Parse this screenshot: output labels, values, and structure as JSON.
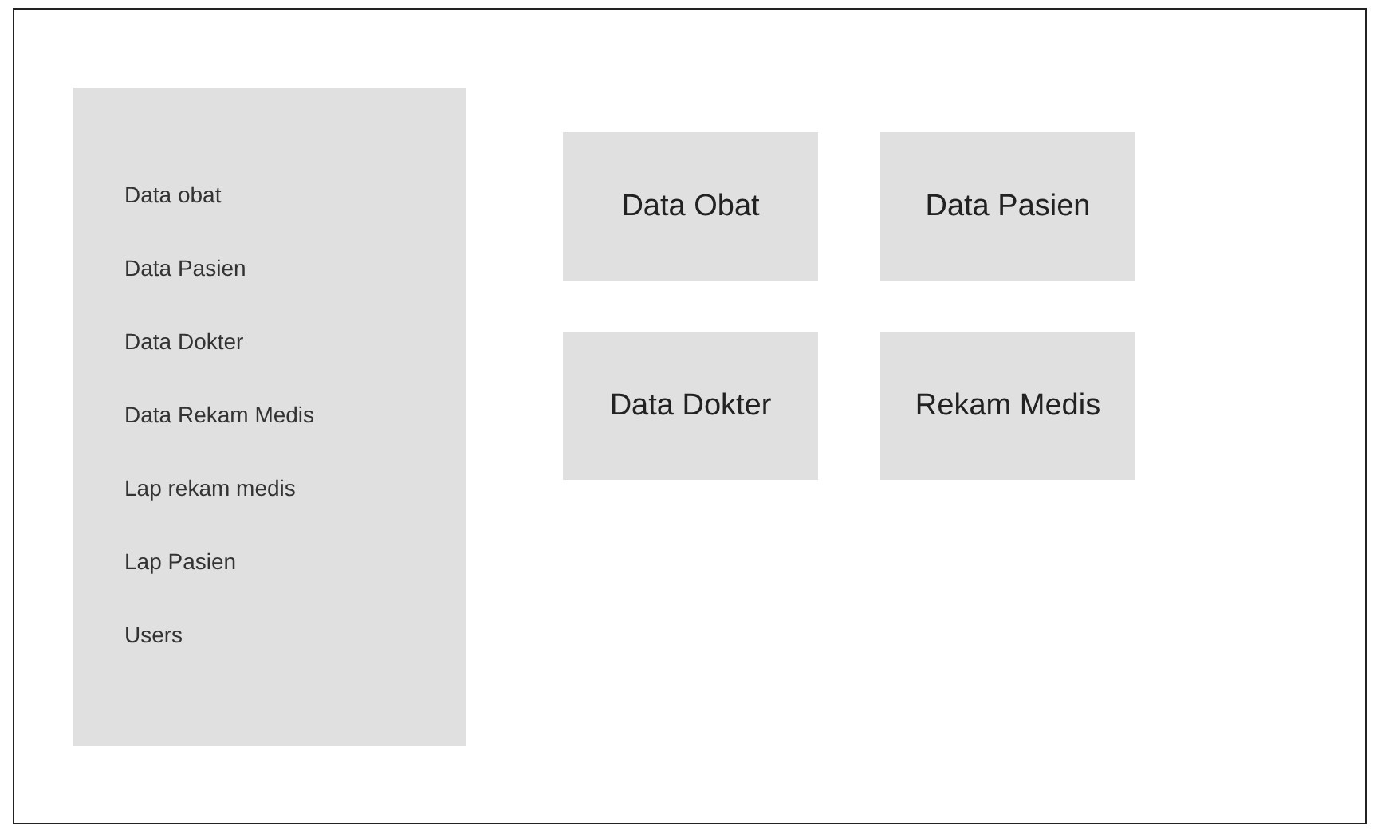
{
  "sidebar": {
    "items": [
      {
        "label": "Data obat"
      },
      {
        "label": "Data Pasien"
      },
      {
        "label": "Data Dokter"
      },
      {
        "label": "Data Rekam Medis"
      },
      {
        "label": "Lap rekam medis"
      },
      {
        "label": "Lap Pasien"
      },
      {
        "label": "Users"
      }
    ]
  },
  "cards": [
    {
      "label": "Data Obat"
    },
    {
      "label": "Data Pasien"
    },
    {
      "label": "Data Dokter"
    },
    {
      "label": "Rekam Medis"
    }
  ]
}
